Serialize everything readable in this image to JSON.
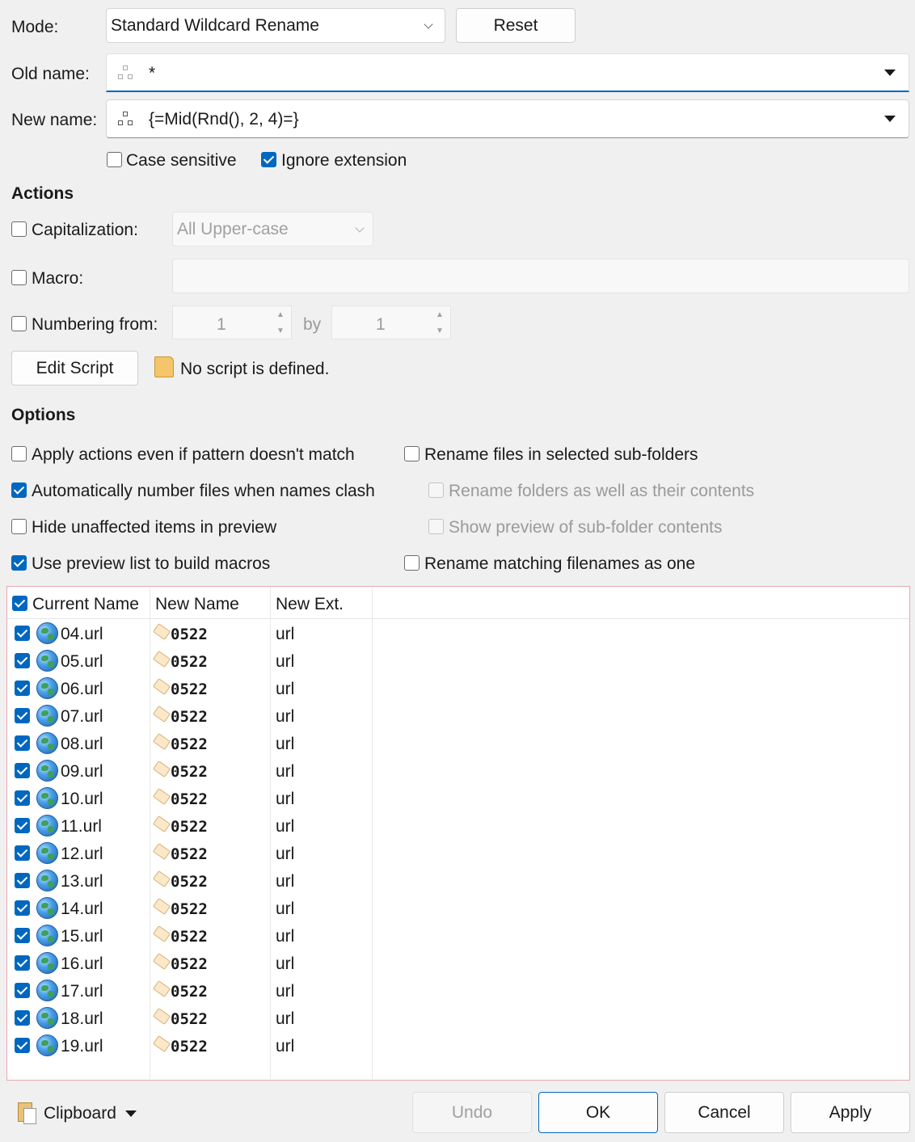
{
  "top": {
    "mode_label": "Mode:",
    "mode_value": "Standard Wildcard Rename",
    "reset_label": "Reset",
    "old_name_label": "Old name:",
    "old_name_value": "*",
    "new_name_label": "New name:",
    "new_name_value": "{=Mid(Rnd(), 2, 4)=}",
    "case_sensitive_label": "Case sensitive",
    "case_sensitive_checked": false,
    "ignore_extension_label": "Ignore extension",
    "ignore_extension_checked": true
  },
  "actions": {
    "heading": "Actions",
    "capitalization_label": "Capitalization:",
    "capitalization_value": "All Upper-case",
    "macro_label": "Macro:",
    "numbering_label": "Numbering from:",
    "numbering_from": "1",
    "by_label": "by",
    "numbering_by": "1",
    "edit_script_label": "Edit Script",
    "script_status": "No script is defined."
  },
  "options": {
    "heading": "Options",
    "left": [
      {
        "label": "Apply actions even if pattern doesn't match",
        "checked": false,
        "enabled": true
      },
      {
        "label": "Automatically number files when names clash",
        "checked": true,
        "enabled": true
      },
      {
        "label": "Hide unaffected items in preview",
        "checked": false,
        "enabled": true
      },
      {
        "label": "Use preview list to build macros",
        "checked": true,
        "enabled": true
      }
    ],
    "right": [
      {
        "label": "Rename files in selected sub-folders",
        "checked": false,
        "enabled": true
      },
      {
        "label": "Rename folders as well as their contents",
        "checked": false,
        "enabled": false
      },
      {
        "label": "Show preview of sub-folder contents",
        "checked": false,
        "enabled": false
      },
      {
        "label": "Rename matching filenames as one",
        "checked": false,
        "enabled": true
      }
    ]
  },
  "preview": {
    "columns": [
      "Current Name",
      "New Name",
      "New Ext."
    ],
    "rows": [
      {
        "current": "04.url",
        "new_name": "0522",
        "new_ext": "url"
      },
      {
        "current": "05.url",
        "new_name": "0522",
        "new_ext": "url"
      },
      {
        "current": "06.url",
        "new_name": "0522",
        "new_ext": "url"
      },
      {
        "current": "07.url",
        "new_name": "0522",
        "new_ext": "url"
      },
      {
        "current": "08.url",
        "new_name": "0522",
        "new_ext": "url"
      },
      {
        "current": "09.url",
        "new_name": "0522",
        "new_ext": "url"
      },
      {
        "current": "10.url",
        "new_name": "0522",
        "new_ext": "url"
      },
      {
        "current": "11.url",
        "new_name": "0522",
        "new_ext": "url"
      },
      {
        "current": "12.url",
        "new_name": "0522",
        "new_ext": "url"
      },
      {
        "current": "13.url",
        "new_name": "0522",
        "new_ext": "url"
      },
      {
        "current": "14.url",
        "new_name": "0522",
        "new_ext": "url"
      },
      {
        "current": "15.url",
        "new_name": "0522",
        "new_ext": "url"
      },
      {
        "current": "16.url",
        "new_name": "0522",
        "new_ext": "url"
      },
      {
        "current": "17.url",
        "new_name": "0522",
        "new_ext": "url"
      },
      {
        "current": "18.url",
        "new_name": "0522",
        "new_ext": "url"
      },
      {
        "current": "19.url",
        "new_name": "0522",
        "new_ext": "url"
      }
    ]
  },
  "footer": {
    "clipboard_label": "Clipboard",
    "undo_label": "Undo",
    "ok_label": "OK",
    "cancel_label": "Cancel",
    "apply_label": "Apply"
  },
  "colors": {
    "accent": "#0067c0",
    "list_border": "#e6a8b2"
  }
}
